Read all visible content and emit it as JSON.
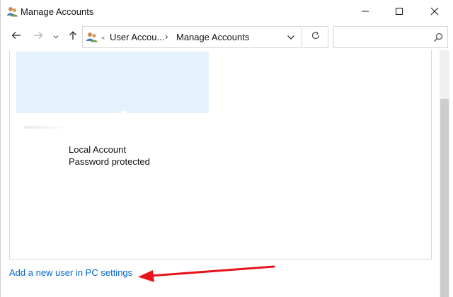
{
  "window": {
    "title": "Manage Accounts"
  },
  "address_bar": {
    "overflow_marker": "«",
    "crumbs": [
      "User Accou...",
      "Manage Accounts"
    ],
    "separator": "›"
  },
  "search": {
    "placeholder": ""
  },
  "account": {
    "type": "Local Account",
    "status": "Password protected"
  },
  "footer": {
    "add_user_link": "Add a new user in PC settings"
  },
  "colors": {
    "link": "#0066cc",
    "tile_highlight": "#e5f1fb",
    "annotation_arrow": "#e8131b"
  },
  "icons": {
    "window": "users-icon",
    "minimize": "minimize-icon",
    "maximize": "maximize-icon",
    "close": "close-icon",
    "back": "arrow-left-icon",
    "forward": "arrow-right-icon",
    "recent": "chevron-down-icon",
    "up": "arrow-up-icon",
    "address": "users-icon",
    "dropdown": "chevron-down-icon",
    "refresh": "refresh-icon",
    "search": "search-icon"
  }
}
